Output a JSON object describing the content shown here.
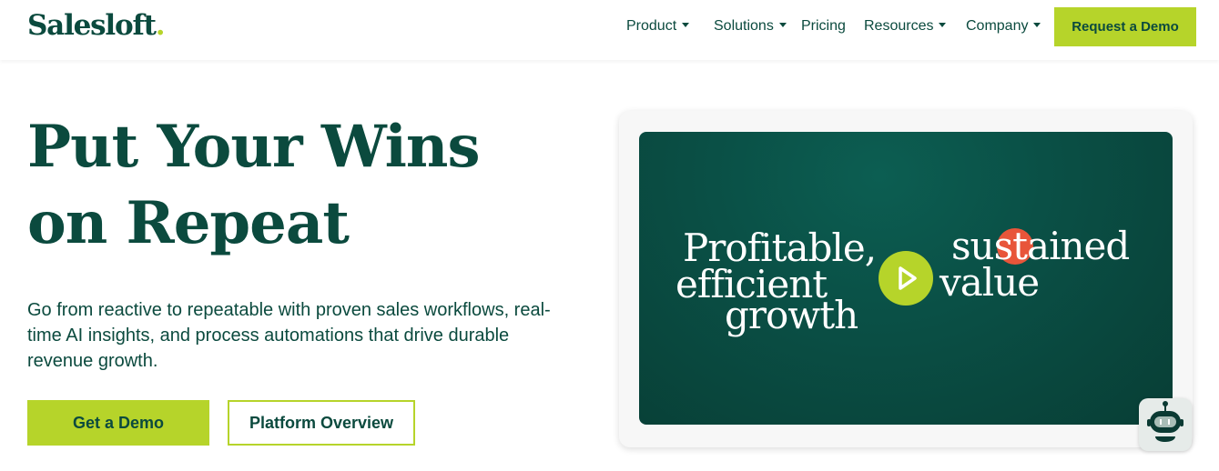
{
  "header": {
    "logo_text": "Salesloft",
    "logo_dot": ".",
    "nav": [
      {
        "label": "Product",
        "dropdown": true
      },
      {
        "label": "Solutions",
        "dropdown": true
      },
      {
        "label": "Pricing",
        "dropdown": false
      },
      {
        "label": "Resources",
        "dropdown": true
      },
      {
        "label": "Company",
        "dropdown": true
      }
    ],
    "cta_label": "Request a Demo"
  },
  "hero": {
    "title_line1": "Put Your Wins",
    "title_line2": "on Repeat",
    "subtitle": "Go from reactive to repeatable with proven sales workflows, real-time AI insights, and process automations that drive durable revenue growth.",
    "primary_button": "Get a Demo",
    "secondary_button": "Platform Overview"
  },
  "video": {
    "line1": "Profitable,",
    "line2": "efficient",
    "line3": "growth",
    "line4": "sustained",
    "line5": "value",
    "play_icon": "play-icon"
  },
  "chatbot": {
    "icon": "robot-icon"
  },
  "colors": {
    "brand_green": "#0b4a3e",
    "accent_lime": "#b6d42a",
    "video_bg": "#0a5046",
    "highlight_red": "#e8553a"
  }
}
